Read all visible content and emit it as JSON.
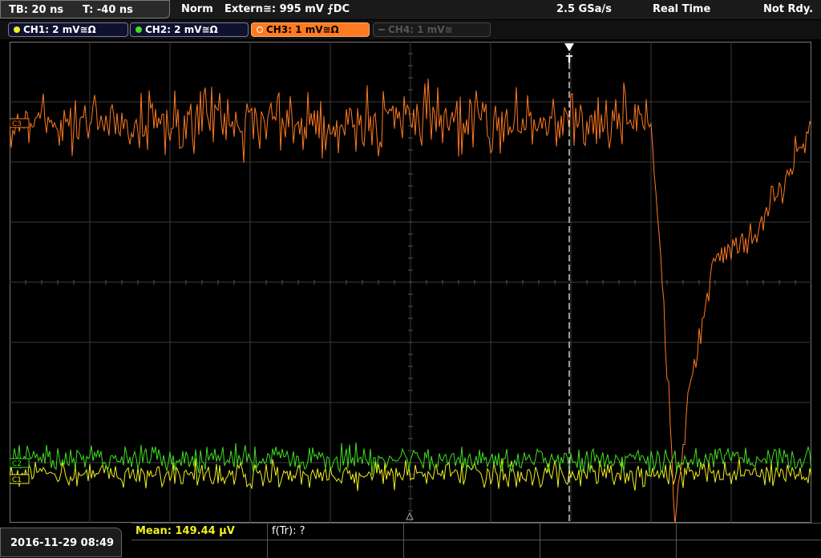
{
  "header": {
    "timebase": "TB: 20 ns",
    "trigger_time": "T: -40 ns",
    "trigger_mode": "Norm",
    "trigger_source": "Extern≅: 995 mV ⨍DC",
    "sample_rate": "2.5 GSa/s",
    "acq_mode": "Real Time",
    "status": "Not Rdy."
  },
  "channels": [
    {
      "id": "ch1",
      "label": "CH1: 2 mV≅Ω",
      "color": "#f0f020",
      "active": true
    },
    {
      "id": "ch2",
      "label": "CH2: 2 mV≅Ω",
      "color": "#40e020",
      "active": true
    },
    {
      "id": "ch3",
      "label": "CH3: 1 mV≅Ω",
      "color": "#ff7a20",
      "active": true,
      "selected": true
    },
    {
      "id": "ch4",
      "label": "CH4: 1 mV≅",
      "color": "#555555",
      "active": false
    }
  ],
  "markers": {
    "ch3": "C3",
    "ch2": "C2",
    "ch1": "C1",
    "trigger": "T"
  },
  "footer": {
    "datetime": "2016-11-29 08:49",
    "mean": "Mean: 149.44 µV",
    "ftr": "f(Tr): ?"
  },
  "colors": {
    "grid": "#3a3a3a",
    "border": "#777777",
    "trigger_line": "#ffffff"
  }
}
